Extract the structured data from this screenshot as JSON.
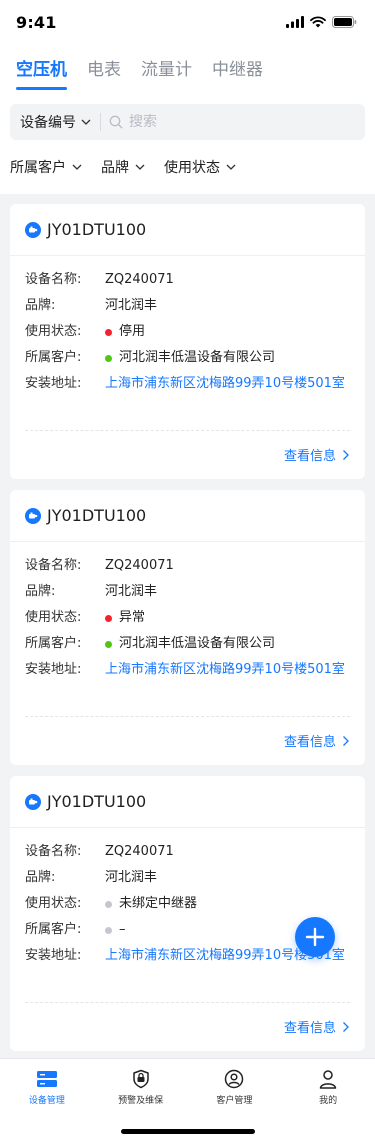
{
  "status_bar": {
    "time": "9:41"
  },
  "tabs": [
    {
      "label": "空压机",
      "active": true
    },
    {
      "label": "电表"
    },
    {
      "label": "流量计"
    },
    {
      "label": "中继器"
    }
  ],
  "search": {
    "select_label": "设备编号",
    "placeholder": "搜索",
    "value": ""
  },
  "filters": [
    "所属客户",
    "品牌",
    "使用状态"
  ],
  "labels": {
    "name": "设备名称:",
    "brand": "品牌:",
    "status": "使用状态:",
    "customer": "所属客户:",
    "address": "安装地址:",
    "view_more": "查看信息"
  },
  "cards": [
    {
      "title": "JY01DTU100",
      "name": "ZQ240071",
      "brand": "河北润丰",
      "status": "停用",
      "status_color": "#f5222d",
      "customer": "河北润丰低温设备有限公司",
      "customer_color": "#52c41a",
      "address": "上海市浦东新区沈梅路99弄10号楼501室"
    },
    {
      "title": "JY01DTU100",
      "name": "ZQ240071",
      "brand": "河北润丰",
      "status": "异常",
      "status_color": "#f5222d",
      "customer": "河北润丰低温设备有限公司",
      "customer_color": "#52c41a",
      "address": "上海市浦东新区沈梅路99弄10号楼501室"
    },
    {
      "title": "JY01DTU100",
      "name": "ZQ240071",
      "brand": "河北润丰",
      "status": "未绑定中继器",
      "status_color": "#c4c7cc",
      "customer": "–",
      "customer_color": "#c4c7cc",
      "address": "上海市浦东新区沈梅路99弄10号楼501室"
    }
  ],
  "tabbar": [
    {
      "label": "设备管理",
      "icon": "device-management-icon",
      "active": true
    },
    {
      "label": "预警及维保",
      "icon": "alert-shield-icon"
    },
    {
      "label": "客户管理",
      "icon": "customer-icon"
    },
    {
      "label": "我的",
      "icon": "profile-icon"
    }
  ],
  "colors": {
    "primary": "#1677ff",
    "stopped": "#f5222d",
    "normal": "#52c41a",
    "unbound": "#c4c7cc"
  }
}
